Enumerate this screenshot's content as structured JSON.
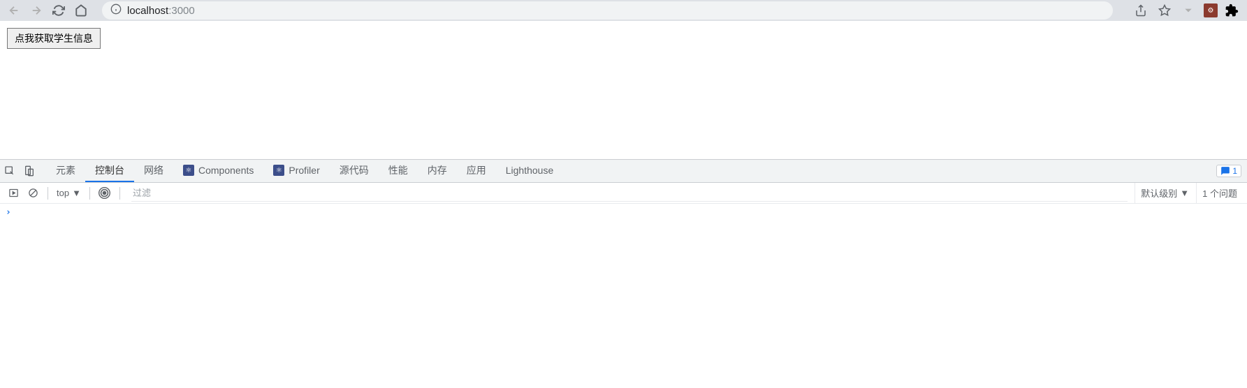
{
  "browser": {
    "url_host": "localhost",
    "url_port": ":3000"
  },
  "page": {
    "button_label": "点我获取学生信息"
  },
  "devtools": {
    "tabs": [
      {
        "label": "元素"
      },
      {
        "label": "控制台"
      },
      {
        "label": "网络"
      },
      {
        "label": "Components",
        "react": true
      },
      {
        "label": "Profiler",
        "react": true
      },
      {
        "label": "源代码"
      },
      {
        "label": "性能"
      },
      {
        "label": "内存"
      },
      {
        "label": "应用"
      },
      {
        "label": "Lighthouse"
      }
    ],
    "active_tab_index": 1,
    "issue_count": "1",
    "console": {
      "context": "top",
      "filter_placeholder": "过滤",
      "level_label": "默认级别",
      "problems_label": "1 个问题",
      "prompt": "›"
    }
  }
}
